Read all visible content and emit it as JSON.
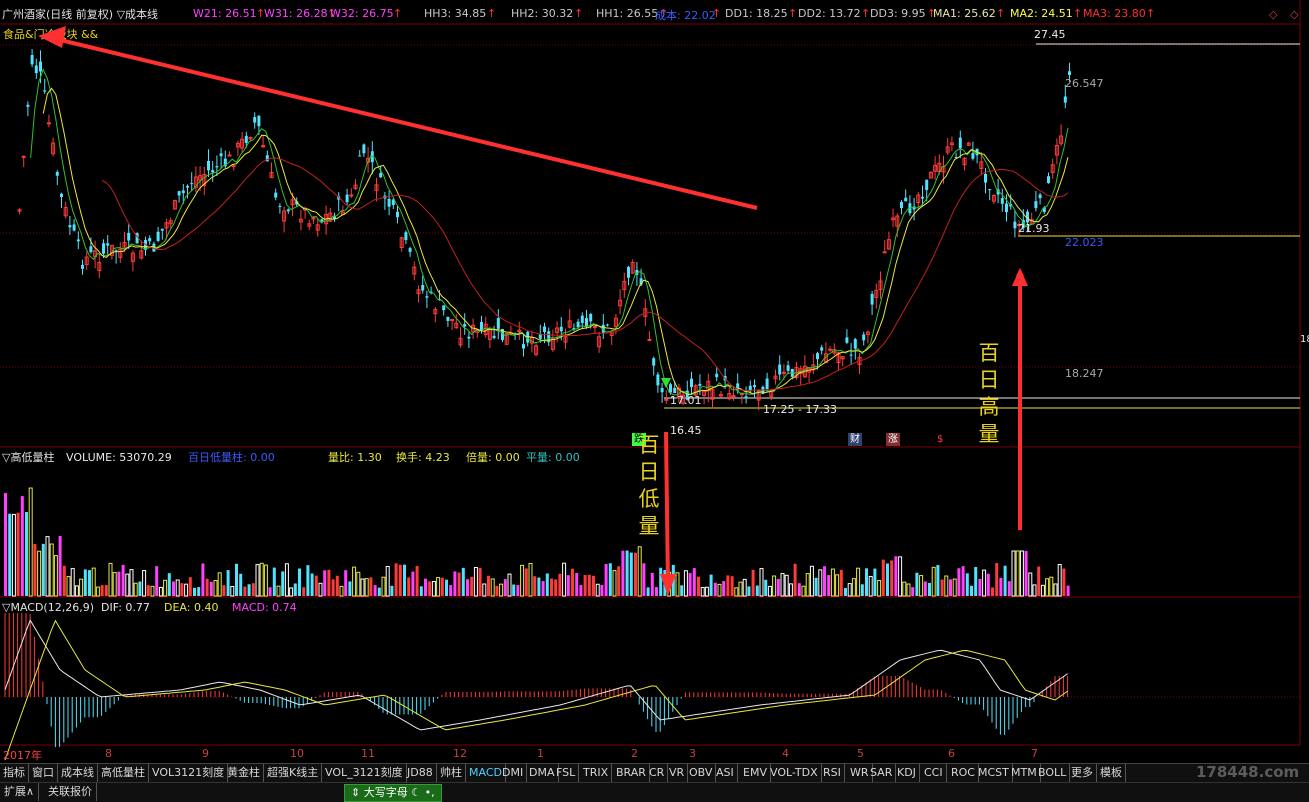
{
  "price_header": {
    "title": "广州酒家(日线 前复权) ▽成本线",
    "items": [
      {
        "label": "W21: 26.51",
        "color": "#ff40ff"
      },
      {
        "label": "W31: 26.28",
        "color": "#ff40ff"
      },
      {
        "label": "W32: 26.75",
        "color": "#ff40ff"
      },
      {
        "label": "HH3: 34.85",
        "color": "#c8c8c8"
      },
      {
        "label": "HH2: 30.32",
        "color": "#c8c8c8"
      },
      {
        "label": "HH1: 26.55",
        "color": "#c8c8c8"
      },
      {
        "label": "成本: 22.02",
        "color": "#3a5aff"
      },
      {
        "label": "DD1: 18.25",
        "color": "#c8c8c8"
      },
      {
        "label": "DD2: 13.72",
        "color": "#c8c8c8"
      },
      {
        "label": "DD3: 9.95",
        "color": "#c8c8c8"
      },
      {
        "label": "MA1: 25.62",
        "color": "#e8e8a0"
      },
      {
        "label": "MA2: 24.51",
        "color": "#ffff40"
      },
      {
        "label": "MA3: 23.80",
        "color": "#ff3030"
      }
    ],
    "sector": "食品&门冷板块 &&"
  },
  "price_labels": {
    "high": "27.45",
    "mid_upper": "26.547",
    "cost_level": "22.023",
    "mid_lower": "18.247",
    "recent_low": "21.93",
    "low_1": "16.45",
    "low_2": "17.01",
    "range": "17.25 - 17.33",
    "right_edge": "18"
  },
  "event_tags": {
    "cai": "财",
    "zhang": "涨",
    "s": "$",
    "jian": "跌"
  },
  "annotations": {
    "low_volume": [
      "百",
      "日",
      "低",
      "量"
    ],
    "high_volume": [
      "百",
      "日",
      "高",
      "量"
    ]
  },
  "volume_header": {
    "title": "▽高低量柱",
    "volume": "VOLUME: 53070.29",
    "baili": "百日低量柱: 0.00",
    "liangbi": "量比: 1.30",
    "huanshou": "换手: 4.23",
    "beiliang": "倍量: 0.00",
    "pingliang": "平量: 0.00"
  },
  "macd_header": {
    "title": "▽MACD(12,26,9)",
    "dif": "DIF: 0.77",
    "dea": "DEA: 0.40",
    "macd": "MACD: 0.74"
  },
  "time_axis": [
    {
      "label": "2017年"
    },
    {
      "label": "8"
    },
    {
      "label": "9"
    },
    {
      "label": "10"
    },
    {
      "label": "11"
    },
    {
      "label": "12"
    },
    {
      "label": "1"
    },
    {
      "label": "2"
    },
    {
      "label": "3"
    },
    {
      "label": "4"
    },
    {
      "label": "5"
    },
    {
      "label": "6"
    },
    {
      "label": "7"
    }
  ],
  "tabs": [
    "指标",
    "窗口",
    "成本线",
    "高低量柱",
    "VOL3121刻度",
    "黄金柱",
    "超强K线主",
    "VOL_3121刻度",
    "JD88",
    "帅柱",
    "MACD",
    "DMI",
    "DMA",
    "FSL",
    "TRIX",
    "BRAR",
    "CR",
    "VR",
    "OBV",
    "ASI",
    "EMV",
    "VOL-TDX",
    "RSI",
    "WR",
    "SAR",
    "KDJ",
    "CCI",
    "ROC",
    "MCST",
    "MTM",
    "BOLL",
    "更多",
    "模板"
  ],
  "active_tab": "MACD",
  "bottom_tabs": [
    "扩展∧",
    "关联报价"
  ],
  "ime": {
    "label": "大写字母"
  },
  "watermark": "178448.com",
  "colors": {
    "up": "#ff3a3a",
    "down": "#4fe3ff",
    "bg": "#000000",
    "grid": "#7a0000"
  }
}
